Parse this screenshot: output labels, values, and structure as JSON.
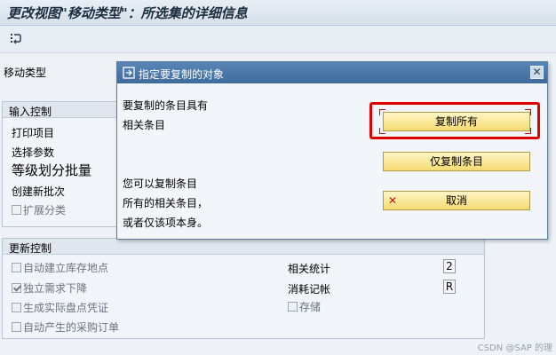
{
  "window": {
    "title": "更改视图\"移动类型\"：所选集的详细信息"
  },
  "toolbar": {
    "icon": "select-detail-icon"
  },
  "main": {
    "movement_type_label": "移动类型",
    "input_control": {
      "header": "输入控制",
      "print_item": "打印项目",
      "select_params": "选择参数",
      "level_batch": "等级划分批量",
      "create_batch": "创建新批次",
      "extend_class": "扩展分类"
    },
    "update_control": {
      "header": "更新控制",
      "auto_create_storage": {
        "label": "自动建立库存地点",
        "checked": false
      },
      "independent_req": {
        "label": "独立需求下降",
        "checked": true
      },
      "gen_inventory_doc": {
        "label": "生成实际盘点凭证",
        "checked": false
      },
      "auto_po": {
        "label": "自动产生的采购订单",
        "checked": false
      },
      "related_stats_label": "相关统计",
      "related_stats_value": "2",
      "consumption_label": "消耗记帐",
      "consumption_value": "R",
      "storage": {
        "label": "存储",
        "checked": false
      }
    }
  },
  "dialog": {
    "title": "指定要复制的对象",
    "line1": "要复制的条目具有",
    "line2": "相关条目",
    "line3": "您可以复制条目",
    "line4": "所有的相关条目，",
    "line5": "或者仅该项本身。",
    "copy_all": "复制所有",
    "copy_only": "仅复制条目",
    "cancel": "取消"
  },
  "watermark": "CSDN @SAP 的理"
}
